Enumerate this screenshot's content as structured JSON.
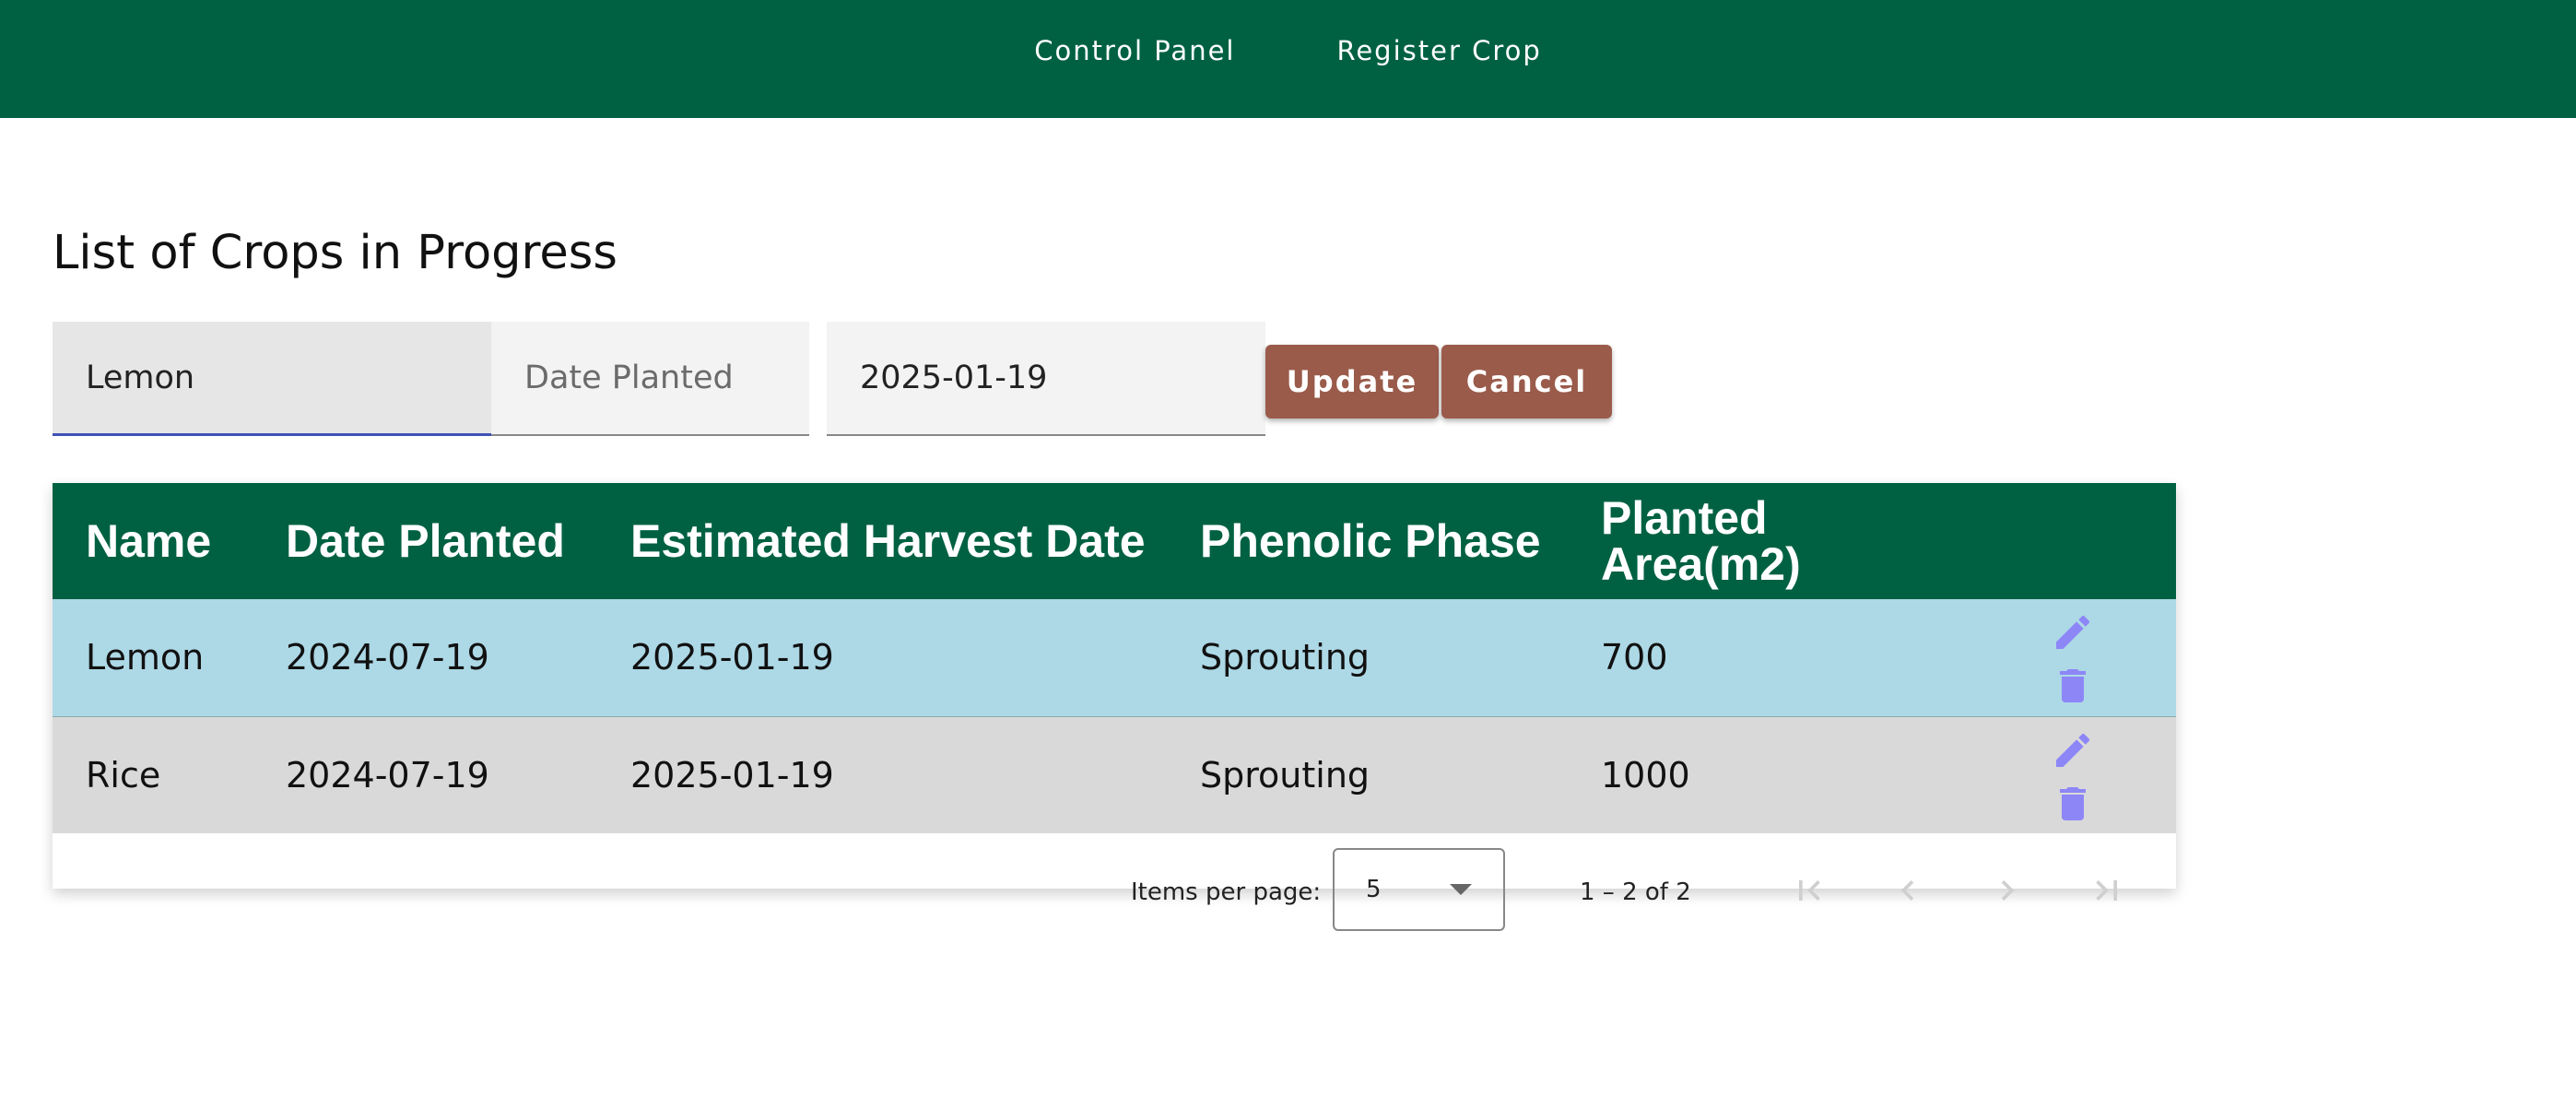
{
  "nav": {
    "control_panel": "Control Panel",
    "register_crop": "Register Crop"
  },
  "page": {
    "title": "List of Crops in Progress"
  },
  "form": {
    "name_value": "Lemon",
    "date_planted_value": "",
    "date_planted_placeholder": "Date Planted",
    "harvest_value": "2025-01-19",
    "update_label": "Update",
    "cancel_label": "Cancel"
  },
  "table": {
    "headers": [
      "Name",
      "Date Planted",
      "Estimated Harvest Date",
      "Phenolic Phase",
      "Planted Area(m2)"
    ],
    "rows": [
      {
        "name": "Lemon",
        "date_planted": "2024-07-19",
        "harvest": "2025-01-19",
        "phase": "Sprouting",
        "area": "700"
      },
      {
        "name": "Rice",
        "date_planted": "2024-07-19",
        "harvest": "2025-01-19",
        "phase": "Sprouting",
        "area": "1000"
      }
    ],
    "icons": {
      "edit": "pencil-icon",
      "delete": "trash-icon"
    }
  },
  "paginator": {
    "items_per_page_label": "Items per page:",
    "page_size": "5",
    "range_label": "1 – 2 of 2",
    "icons": [
      "first-page-icon",
      "previous-page-icon",
      "next-page-icon",
      "last-page-icon"
    ]
  },
  "colors": {
    "header_green": "#006142",
    "button_brown": "#9a5b4b",
    "selected_row": "#add8e6",
    "alt_row": "#d9d9d9",
    "action_icon": "#8d86f7"
  }
}
